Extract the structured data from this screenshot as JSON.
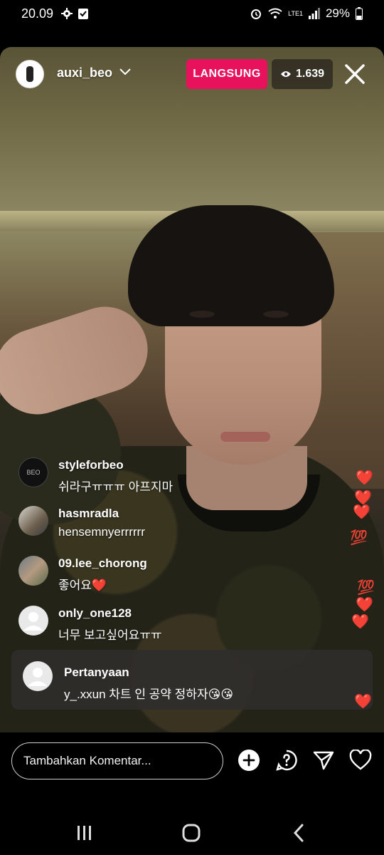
{
  "status_bar": {
    "time": "20.09",
    "battery": "29%",
    "network": "LTE1"
  },
  "live": {
    "username": "auxi_beo",
    "badge": "LANGSUNG",
    "viewers": "1.639"
  },
  "comments": [
    {
      "user": "styleforbeo",
      "text": "쉬라구ㅠㅠㅠ 아프지마",
      "avatar_label": "BEO"
    },
    {
      "user": "hasmradla",
      "text": "hensemnyerrrrrr"
    },
    {
      "user": "09.lee_chorong",
      "text": "좋어요❤️"
    },
    {
      "user": "only_one128",
      "text": "너무 보고싶어요ㅠㅠ"
    }
  ],
  "question": {
    "title": "Pertanyaan",
    "text": "y_.xxun 차트 인 공약 정하자😘😘"
  },
  "reactions": [
    "heart",
    "heart",
    "hundred",
    "hundred",
    "heart",
    "heart",
    "heart"
  ],
  "composer": {
    "placeholder": "Tambahkan Komentar..."
  },
  "colors": {
    "live_badge": "#e8125c",
    "heart": "#e0262f"
  }
}
